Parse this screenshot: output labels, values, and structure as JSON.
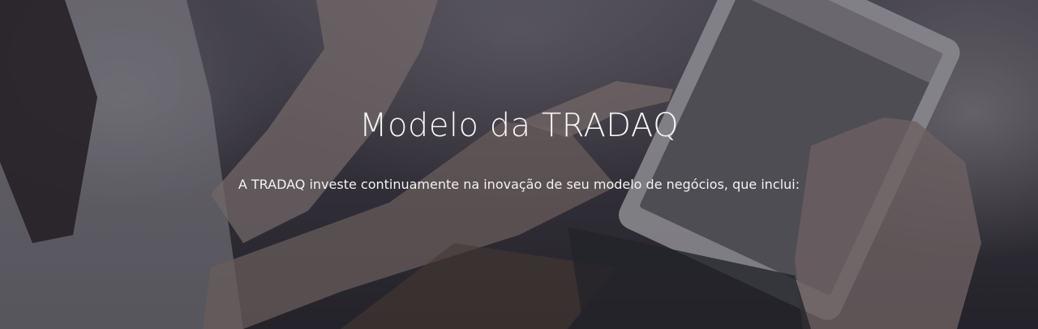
{
  "hero": {
    "title": "Modelo da TRADAQ",
    "subtitle": "A TRADAQ investe continuamente na inovação de seu modelo de negócios, que inclui:",
    "overlay_color": "#19161e"
  }
}
